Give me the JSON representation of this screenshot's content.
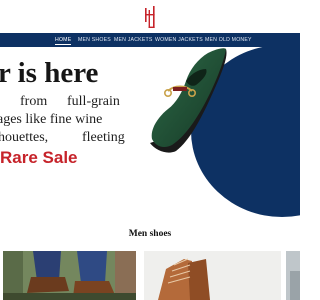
{
  "brand": {
    "logo_icon": "hl-monogram-logo"
  },
  "nav": {
    "items": [
      {
        "label": "Home",
        "active": true
      },
      {
        "label": "Men shoes",
        "active": false
      },
      {
        "label": "Men Jackets",
        "active": false
      },
      {
        "label": "Women Jackets",
        "active": false
      },
      {
        "label": "Men old money",
        "active": false
      }
    ]
  },
  "hero": {
    "title": "r is here",
    "line1_a": "from",
    "line1_b": "full-grain",
    "line2": "ages like fine wine",
    "line3_a": "houettes,",
    "line3_b": "fleeting",
    "sale": "Rare Sale",
    "image_icon": "green-loafer-image"
  },
  "section": {
    "title": "Men shoes"
  },
  "products": [
    {
      "image_icon": "man-blue-trousers-brown-shoes-photo"
    },
    {
      "image_icon": "brown-leather-boot-photo"
    },
    {
      "image_icon": "partial-product-photo"
    }
  ],
  "colors": {
    "navy": "#0d3163",
    "accent_red": "#c6232a",
    "loafer_green": "#1f4a33"
  }
}
